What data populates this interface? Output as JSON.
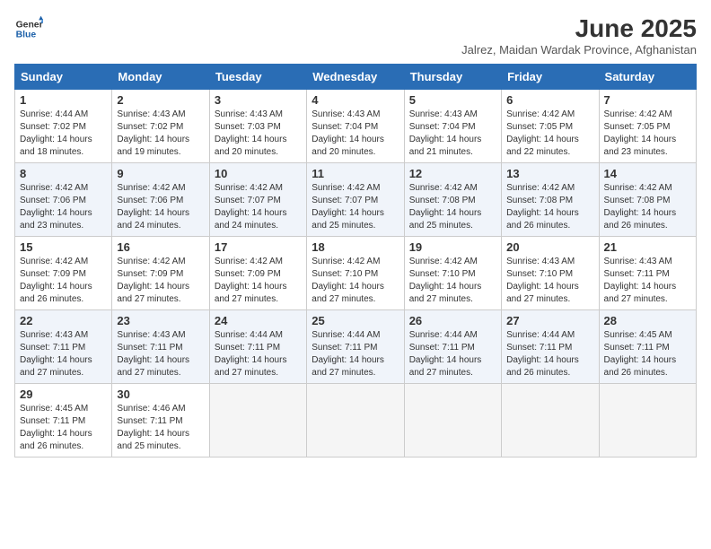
{
  "header": {
    "logo_line1": "General",
    "logo_line2": "Blue",
    "month": "June 2025",
    "location": "Jalrez, Maidan Wardak Province, Afghanistan"
  },
  "weekdays": [
    "Sunday",
    "Monday",
    "Tuesday",
    "Wednesday",
    "Thursday",
    "Friday",
    "Saturday"
  ],
  "weeks": [
    [
      {
        "day": 1,
        "rise": "4:44 AM",
        "set": "7:02 PM",
        "hours": "14 hours and 18 minutes."
      },
      {
        "day": 2,
        "rise": "4:43 AM",
        "set": "7:02 PM",
        "hours": "14 hours and 19 minutes."
      },
      {
        "day": 3,
        "rise": "4:43 AM",
        "set": "7:03 PM",
        "hours": "14 hours and 20 minutes."
      },
      {
        "day": 4,
        "rise": "4:43 AM",
        "set": "7:04 PM",
        "hours": "14 hours and 20 minutes."
      },
      {
        "day": 5,
        "rise": "4:43 AM",
        "set": "7:04 PM",
        "hours": "14 hours and 21 minutes."
      },
      {
        "day": 6,
        "rise": "4:42 AM",
        "set": "7:05 PM",
        "hours": "14 hours and 22 minutes."
      },
      {
        "day": 7,
        "rise": "4:42 AM",
        "set": "7:05 PM",
        "hours": "14 hours and 23 minutes."
      }
    ],
    [
      {
        "day": 8,
        "rise": "4:42 AM",
        "set": "7:06 PM",
        "hours": "14 hours and 23 minutes."
      },
      {
        "day": 9,
        "rise": "4:42 AM",
        "set": "7:06 PM",
        "hours": "14 hours and 24 minutes."
      },
      {
        "day": 10,
        "rise": "4:42 AM",
        "set": "7:07 PM",
        "hours": "14 hours and 24 minutes."
      },
      {
        "day": 11,
        "rise": "4:42 AM",
        "set": "7:07 PM",
        "hours": "14 hours and 25 minutes."
      },
      {
        "day": 12,
        "rise": "4:42 AM",
        "set": "7:08 PM",
        "hours": "14 hours and 25 minutes."
      },
      {
        "day": 13,
        "rise": "4:42 AM",
        "set": "7:08 PM",
        "hours": "14 hours and 26 minutes."
      },
      {
        "day": 14,
        "rise": "4:42 AM",
        "set": "7:08 PM",
        "hours": "14 hours and 26 minutes."
      }
    ],
    [
      {
        "day": 15,
        "rise": "4:42 AM",
        "set": "7:09 PM",
        "hours": "14 hours and 26 minutes."
      },
      {
        "day": 16,
        "rise": "4:42 AM",
        "set": "7:09 PM",
        "hours": "14 hours and 27 minutes."
      },
      {
        "day": 17,
        "rise": "4:42 AM",
        "set": "7:09 PM",
        "hours": "14 hours and 27 minutes."
      },
      {
        "day": 18,
        "rise": "4:42 AM",
        "set": "7:10 PM",
        "hours": "14 hours and 27 minutes."
      },
      {
        "day": 19,
        "rise": "4:42 AM",
        "set": "7:10 PM",
        "hours": "14 hours and 27 minutes."
      },
      {
        "day": 20,
        "rise": "4:43 AM",
        "set": "7:10 PM",
        "hours": "14 hours and 27 minutes."
      },
      {
        "day": 21,
        "rise": "4:43 AM",
        "set": "7:11 PM",
        "hours": "14 hours and 27 minutes."
      }
    ],
    [
      {
        "day": 22,
        "rise": "4:43 AM",
        "set": "7:11 PM",
        "hours": "14 hours and 27 minutes."
      },
      {
        "day": 23,
        "rise": "4:43 AM",
        "set": "7:11 PM",
        "hours": "14 hours and 27 minutes."
      },
      {
        "day": 24,
        "rise": "4:44 AM",
        "set": "7:11 PM",
        "hours": "14 hours and 27 minutes."
      },
      {
        "day": 25,
        "rise": "4:44 AM",
        "set": "7:11 PM",
        "hours": "14 hours and 27 minutes."
      },
      {
        "day": 26,
        "rise": "4:44 AM",
        "set": "7:11 PM",
        "hours": "14 hours and 27 minutes."
      },
      {
        "day": 27,
        "rise": "4:44 AM",
        "set": "7:11 PM",
        "hours": "14 hours and 26 minutes."
      },
      {
        "day": 28,
        "rise": "4:45 AM",
        "set": "7:11 PM",
        "hours": "14 hours and 26 minutes."
      }
    ],
    [
      {
        "day": 29,
        "rise": "4:45 AM",
        "set": "7:11 PM",
        "hours": "14 hours and 26 minutes."
      },
      {
        "day": 30,
        "rise": "4:46 AM",
        "set": "7:11 PM",
        "hours": "14 hours and 25 minutes."
      },
      null,
      null,
      null,
      null,
      null
    ]
  ]
}
